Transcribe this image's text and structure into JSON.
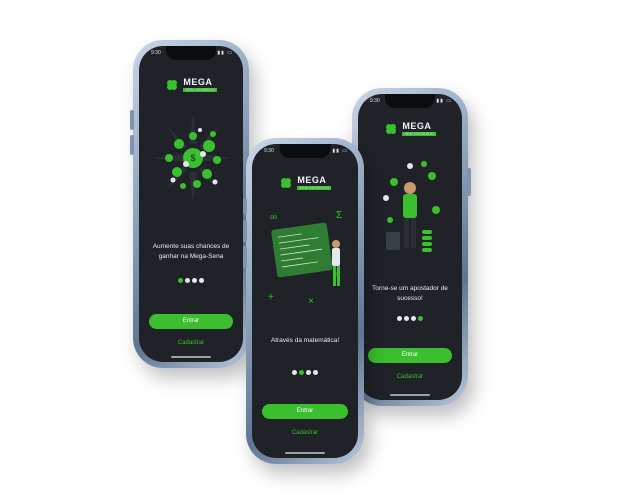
{
  "colors": {
    "accent": "#3bbf2f",
    "screen_bg": "#1f2328",
    "text": "#e8ecef"
  },
  "status_time": "9:30",
  "logo": {
    "title": "MEGA",
    "subtitle": "SEM SEGREDO"
  },
  "buttons": {
    "enter": "Entrar",
    "signup": "Cadastrar"
  },
  "screens": [
    {
      "caption": "Aumente suas chances de ganhar na Mega-Sena",
      "active_dot": 1
    },
    {
      "caption": "Através da matemática!",
      "active_dot": 2
    },
    {
      "caption": "Torne-se um apostador de sucesso!",
      "active_dot": 4
    }
  ],
  "icons": [
    "signal-icon",
    "battery-icon",
    "clover-logo-icon"
  ]
}
